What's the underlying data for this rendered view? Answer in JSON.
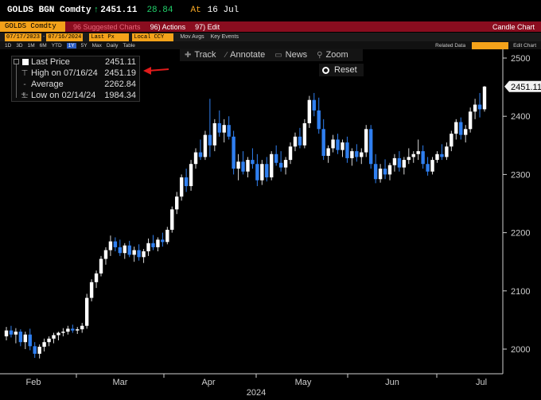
{
  "ticker": {
    "symbol": "GOLDS BGN Comdty",
    "arrow": "↑",
    "price": "2451.11",
    "change": "28.84",
    "at": "At",
    "date": "16 Jul"
  },
  "command_bar": {
    "security": "GOLDS Comdty",
    "suggested": "96 Suggested Charts",
    "actions": "Actions",
    "actions_key": "96)",
    "edit": "Edit",
    "edit_key": "97)",
    "title": "Candle Chart"
  },
  "date_bar": {
    "start": "07/17/2023",
    "separator": "-",
    "end": "07/16/2024",
    "period": "Last Px",
    "currency": "Local CCY",
    "mov_avgs": "Mov Avgs",
    "key_events": "Key Events"
  },
  "period_bar": {
    "items": [
      "1D",
      "3D",
      "1M",
      "6M",
      "YTD",
      "1Y",
      "5Y",
      "Max",
      "Daily"
    ],
    "selected": "1Y",
    "table": "Table",
    "related": "Related Data",
    "edit_chart": "Edit Chart"
  },
  "toolbar": {
    "track": "Track",
    "annotate": "Annotate",
    "news": "News",
    "zoom": "Zoom",
    "reset": "Reset"
  },
  "legend": {
    "last_label": "Last Price",
    "last_value": "2451.11",
    "high_label": "High on 07/16/24",
    "high_value": "2451.19",
    "avg_label": "Average",
    "avg_value": "2262.84",
    "low_label": "Low on 02/14/24",
    "low_value": "1984.34"
  },
  "colors": {
    "up": "#ffffff",
    "down": "#2f7ff0",
    "axis": "#cfcfcf",
    "arrow": "#e01b1b"
  },
  "chart_data": {
    "type": "candlestick",
    "yticks": [
      "2500",
      "2400",
      "2300",
      "2200",
      "2100",
      "2000"
    ],
    "xticks": [
      "Feb",
      "Mar",
      "Apr",
      "May",
      "Jun",
      "Jul"
    ],
    "year": "2024",
    "last_price_tag": "2451.11",
    "ylim": [
      1970,
      2510
    ],
    "candles": [
      [
        2022,
        2038,
        2015,
        2032
      ],
      [
        2032,
        2040,
        2020,
        2025
      ],
      [
        2025,
        2036,
        2010,
        2030
      ],
      [
        2030,
        2034,
        2005,
        2012
      ],
      [
        2012,
        2030,
        2000,
        2025
      ],
      [
        2025,
        2035,
        1998,
        2005
      ],
      [
        2005,
        2012,
        1985,
        1992
      ],
      [
        1992,
        2008,
        1984,
        2004
      ],
      [
        2004,
        2018,
        1996,
        2012
      ],
      [
        2012,
        2022,
        2005,
        2018
      ],
      [
        2018,
        2028,
        2010,
        2024
      ],
      [
        2024,
        2030,
        2015,
        2028
      ],
      [
        2028,
        2036,
        2022,
        2030
      ],
      [
        2030,
        2040,
        2025,
        2035
      ],
      [
        2035,
        2042,
        2028,
        2032
      ],
      [
        2032,
        2038,
        2026,
        2034
      ],
      [
        2034,
        2045,
        2028,
        2040
      ],
      [
        2040,
        2095,
        2035,
        2088
      ],
      [
        2088,
        2120,
        2082,
        2115
      ],
      [
        2115,
        2135,
        2105,
        2130
      ],
      [
        2130,
        2160,
        2125,
        2155
      ],
      [
        2155,
        2175,
        2145,
        2170
      ],
      [
        2170,
        2195,
        2160,
        2185
      ],
      [
        2185,
        2192,
        2168,
        2175
      ],
      [
        2175,
        2188,
        2160,
        2165
      ],
      [
        2165,
        2182,
        2155,
        2178
      ],
      [
        2178,
        2186,
        2158,
        2162
      ],
      [
        2162,
        2176,
        2150,
        2170
      ],
      [
        2170,
        2180,
        2152,
        2158
      ],
      [
        2158,
        2172,
        2148,
        2168
      ],
      [
        2168,
        2190,
        2160,
        2182
      ],
      [
        2182,
        2196,
        2170,
        2175
      ],
      [
        2175,
        2192,
        2168,
        2188
      ],
      [
        2188,
        2200,
        2176,
        2184
      ],
      [
        2184,
        2210,
        2180,
        2205
      ],
      [
        2205,
        2245,
        2200,
        2240
      ],
      [
        2240,
        2270,
        2232,
        2262
      ],
      [
        2262,
        2300,
        2255,
        2295
      ],
      [
        2295,
        2310,
        2270,
        2280
      ],
      [
        2280,
        2325,
        2272,
        2318
      ],
      [
        2318,
        2345,
        2310,
        2338
      ],
      [
        2338,
        2360,
        2325,
        2330
      ],
      [
        2330,
        2375,
        2325,
        2368
      ],
      [
        2368,
        2430,
        2330,
        2350
      ],
      [
        2350,
        2395,
        2340,
        2388
      ],
      [
        2388,
        2410,
        2365,
        2372
      ],
      [
        2372,
        2395,
        2355,
        2385
      ],
      [
        2385,
        2400,
        2360,
        2365
      ],
      [
        2365,
        2375,
        2300,
        2310
      ],
      [
        2310,
        2335,
        2290,
        2322
      ],
      [
        2322,
        2340,
        2300,
        2305
      ],
      [
        2305,
        2330,
        2295,
        2325
      ],
      [
        2325,
        2345,
        2310,
        2318
      ],
      [
        2318,
        2335,
        2280,
        2290
      ],
      [
        2290,
        2325,
        2282,
        2318
      ],
      [
        2318,
        2330,
        2288,
        2295
      ],
      [
        2295,
        2340,
        2290,
        2335
      ],
      [
        2335,
        2350,
        2315,
        2320
      ],
      [
        2320,
        2340,
        2305,
        2312
      ],
      [
        2312,
        2330,
        2300,
        2325
      ],
      [
        2325,
        2355,
        2318,
        2348
      ],
      [
        2348,
        2372,
        2340,
        2365
      ],
      [
        2365,
        2380,
        2345,
        2350
      ],
      [
        2350,
        2395,
        2345,
        2388
      ],
      [
        2388,
        2435,
        2380,
        2428
      ],
      [
        2428,
        2440,
        2400,
        2410
      ],
      [
        2410,
        2432,
        2370,
        2378
      ],
      [
        2378,
        2395,
        2325,
        2332
      ],
      [
        2332,
        2350,
        2320,
        2345
      ],
      [
        2345,
        2368,
        2338,
        2360
      ],
      [
        2360,
        2370,
        2335,
        2342
      ],
      [
        2342,
        2360,
        2330,
        2355
      ],
      [
        2355,
        2365,
        2320,
        2328
      ],
      [
        2328,
        2345,
        2315,
        2340
      ],
      [
        2340,
        2352,
        2322,
        2330
      ],
      [
        2330,
        2345,
        2318,
        2338
      ],
      [
        2338,
        2385,
        2330,
        2378
      ],
      [
        2378,
        2385,
        2310,
        2318
      ],
      [
        2318,
        2335,
        2285,
        2292
      ],
      [
        2292,
        2318,
        2286,
        2310
      ],
      [
        2310,
        2326,
        2292,
        2300
      ],
      [
        2300,
        2320,
        2290,
        2316
      ],
      [
        2316,
        2335,
        2305,
        2328
      ],
      [
        2328,
        2340,
        2305,
        2312
      ],
      [
        2312,
        2330,
        2300,
        2325
      ],
      [
        2325,
        2345,
        2318,
        2330
      ],
      [
        2330,
        2340,
        2320,
        2335
      ],
      [
        2335,
        2360,
        2325,
        2340
      ],
      [
        2340,
        2350,
        2310,
        2318
      ],
      [
        2318,
        2330,
        2298,
        2305
      ],
      [
        2305,
        2330,
        2300,
        2325
      ],
      [
        2325,
        2340,
        2320,
        2335
      ],
      [
        2335,
        2352,
        2325,
        2330
      ],
      [
        2330,
        2355,
        2325,
        2348
      ],
      [
        2348,
        2375,
        2340,
        2370
      ],
      [
        2370,
        2395,
        2360,
        2390
      ],
      [
        2390,
        2398,
        2360,
        2368
      ],
      [
        2368,
        2385,
        2355,
        2378
      ],
      [
        2378,
        2415,
        2372,
        2408
      ],
      [
        2408,
        2430,
        2395,
        2420
      ],
      [
        2420,
        2440,
        2398,
        2412
      ],
      [
        2412,
        2452,
        2408,
        2451
      ]
    ]
  }
}
